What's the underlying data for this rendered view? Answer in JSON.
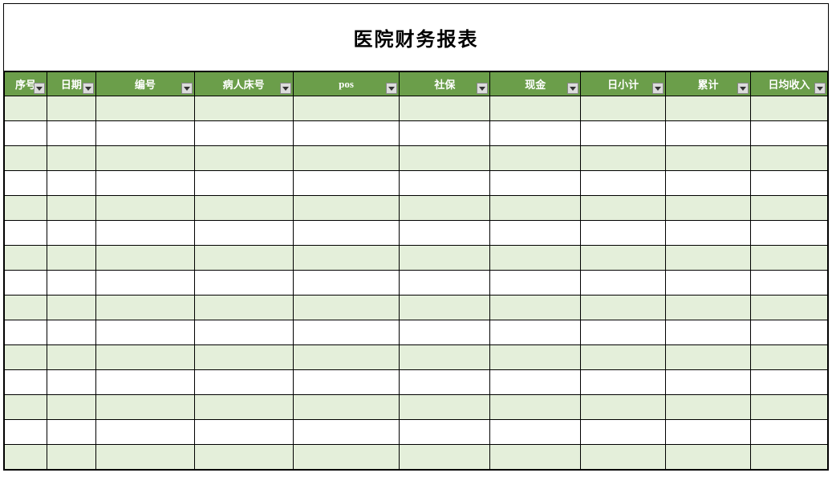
{
  "title": "医院财务报表",
  "columns": [
    {
      "key": "seq",
      "label": "序号"
    },
    {
      "key": "date",
      "label": "日期"
    },
    {
      "key": "code",
      "label": "编号"
    },
    {
      "key": "bed",
      "label": "病人床号"
    },
    {
      "key": "pos",
      "label": "pos"
    },
    {
      "key": "ins",
      "label": "社保"
    },
    {
      "key": "cash",
      "label": "现金"
    },
    {
      "key": "daily",
      "label": "日小计"
    },
    {
      "key": "total",
      "label": "累计"
    },
    {
      "key": "avg",
      "label": "日均收入"
    }
  ],
  "rows": [
    {
      "seq": "",
      "date": "",
      "code": "",
      "bed": "",
      "pos": "",
      "ins": "",
      "cash": "",
      "daily": "",
      "total": "",
      "avg": ""
    },
    {
      "seq": "",
      "date": "",
      "code": "",
      "bed": "",
      "pos": "",
      "ins": "",
      "cash": "",
      "daily": "",
      "total": "",
      "avg": ""
    },
    {
      "seq": "",
      "date": "",
      "code": "",
      "bed": "",
      "pos": "",
      "ins": "",
      "cash": "",
      "daily": "",
      "total": "",
      "avg": ""
    },
    {
      "seq": "",
      "date": "",
      "code": "",
      "bed": "",
      "pos": "",
      "ins": "",
      "cash": "",
      "daily": "",
      "total": "",
      "avg": ""
    },
    {
      "seq": "",
      "date": "",
      "code": "",
      "bed": "",
      "pos": "",
      "ins": "",
      "cash": "",
      "daily": "",
      "total": "",
      "avg": ""
    },
    {
      "seq": "",
      "date": "",
      "code": "",
      "bed": "",
      "pos": "",
      "ins": "",
      "cash": "",
      "daily": "",
      "total": "",
      "avg": ""
    },
    {
      "seq": "",
      "date": "",
      "code": "",
      "bed": "",
      "pos": "",
      "ins": "",
      "cash": "",
      "daily": "",
      "total": "",
      "avg": ""
    },
    {
      "seq": "",
      "date": "",
      "code": "",
      "bed": "",
      "pos": "",
      "ins": "",
      "cash": "",
      "daily": "",
      "total": "",
      "avg": ""
    },
    {
      "seq": "",
      "date": "",
      "code": "",
      "bed": "",
      "pos": "",
      "ins": "",
      "cash": "",
      "daily": "",
      "total": "",
      "avg": ""
    },
    {
      "seq": "",
      "date": "",
      "code": "",
      "bed": "",
      "pos": "",
      "ins": "",
      "cash": "",
      "daily": "",
      "total": "",
      "avg": ""
    },
    {
      "seq": "",
      "date": "",
      "code": "",
      "bed": "",
      "pos": "",
      "ins": "",
      "cash": "",
      "daily": "",
      "total": "",
      "avg": ""
    },
    {
      "seq": "",
      "date": "",
      "code": "",
      "bed": "",
      "pos": "",
      "ins": "",
      "cash": "",
      "daily": "",
      "total": "",
      "avg": ""
    },
    {
      "seq": "",
      "date": "",
      "code": "",
      "bed": "",
      "pos": "",
      "ins": "",
      "cash": "",
      "daily": "",
      "total": "",
      "avg": ""
    },
    {
      "seq": "",
      "date": "",
      "code": "",
      "bed": "",
      "pos": "",
      "ins": "",
      "cash": "",
      "daily": "",
      "total": "",
      "avg": ""
    },
    {
      "seq": "",
      "date": "",
      "code": "",
      "bed": "",
      "pos": "",
      "ins": "",
      "cash": "",
      "daily": "",
      "total": "",
      "avg": ""
    }
  ]
}
